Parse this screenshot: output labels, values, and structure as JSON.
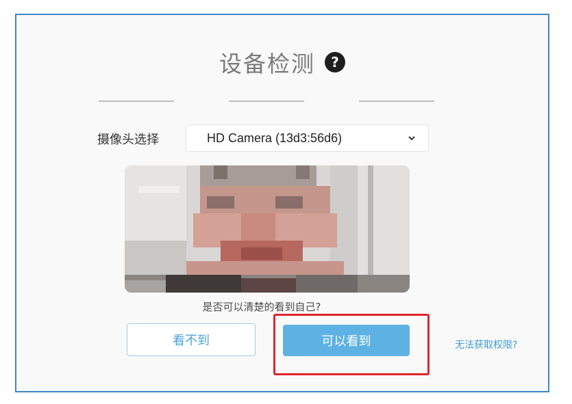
{
  "header": {
    "title": "设备检测",
    "help_icon": "?"
  },
  "camera": {
    "label": "摄像头选择",
    "selected": "HD Camera (13d3:56d6)"
  },
  "prompt": {
    "question": "是否可以清楚的看到自己?"
  },
  "actions": {
    "cannot_see_label": "看不到",
    "can_see_label": "可以看到",
    "no_permission_link": "无法获取权限?"
  },
  "colors": {
    "border": "#3c87c7",
    "primary": "#5db2e3",
    "link": "#3d9ad6",
    "highlight": "#e0242b"
  },
  "icons": {
    "help": "question-circle-icon",
    "dropdown": "chevron-down-icon"
  }
}
